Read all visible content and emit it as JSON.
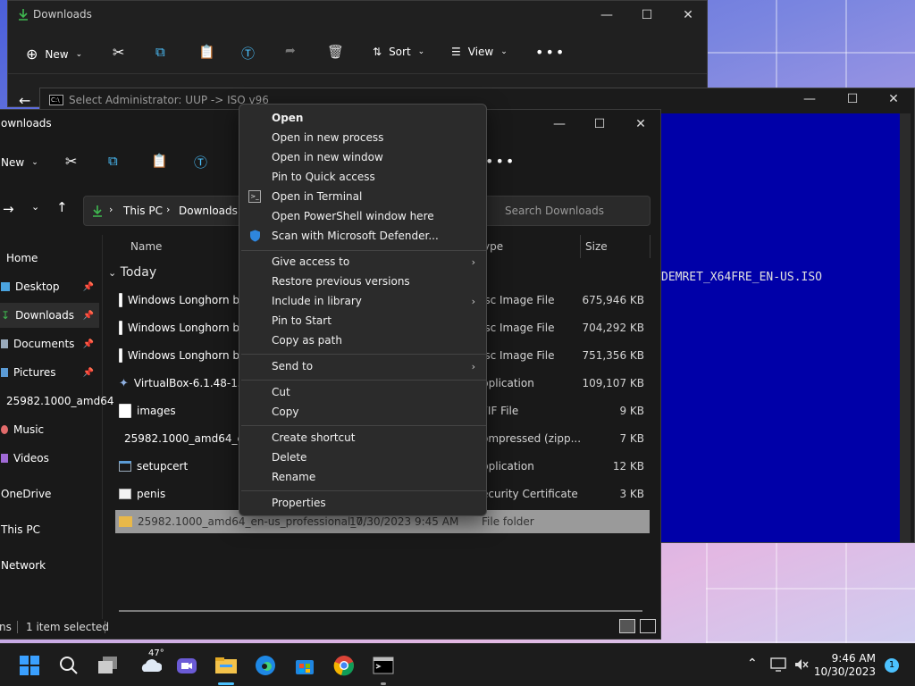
{
  "back_explorer": {
    "title": "Downloads",
    "new_label": "New",
    "sort_label": "Sort",
    "view_label": "View"
  },
  "console": {
    "title": "Select Administrator:  UUP -> ISO v96",
    "output_line": "DEMRET_X64FRE_EN-US.ISO"
  },
  "explorer": {
    "title": "ownloads",
    "new_label": "New",
    "breadcrumb": [
      "This PC",
      "Downloads"
    ],
    "search_placeholder": "Search Downloads",
    "columns": {
      "name": "Name",
      "type": "ype",
      "size": "Size"
    },
    "group": "Today",
    "nav": [
      {
        "label": "Home"
      },
      {
        "label": "Desktop",
        "pinned": true
      },
      {
        "label": "Downloads",
        "pinned": true
      },
      {
        "label": "Documents",
        "pinned": true
      },
      {
        "label": "Pictures",
        "pinned": true
      },
      {
        "label": "25982.1000_amd64"
      },
      {
        "label": "Music"
      },
      {
        "label": "Videos"
      },
      {
        "label": "OneDrive"
      },
      {
        "label": "This PC"
      },
      {
        "label": "Network"
      }
    ],
    "rows": [
      {
        "name": "Windows Longhorn b",
        "type": "isc Image File",
        "size": "675,946 KB"
      },
      {
        "name": "Windows Longhorn b",
        "type": "isc Image File",
        "size": "704,292 KB"
      },
      {
        "name": "Windows Longhorn b",
        "type": "isc Image File",
        "size": "751,356 KB"
      },
      {
        "name": "VirtualBox-6.1.48-159",
        "type": "pplication",
        "size": "109,107 KB"
      },
      {
        "name": "images",
        "type": "FIF File",
        "size": "9 KB"
      },
      {
        "name": "25982.1000_amd64_en",
        "type": "ompressed (zipp...",
        "size": "7 KB"
      },
      {
        "name": "setupcert",
        "type": "pplication",
        "size": "12 KB"
      },
      {
        "name": "penis",
        "type": "ecurity Certificate",
        "size": "3 KB"
      }
    ],
    "selected_row": {
      "name": "25982.1000_amd64_en-us_professional_7...",
      "date": "10/30/2023 9:45 AM",
      "type": "File folder"
    },
    "status_left": "ns",
    "status_selected": "1 item selected"
  },
  "context_menu": {
    "items": [
      {
        "label": "Open",
        "bold": true
      },
      {
        "label": "Open in new process"
      },
      {
        "label": "Open in new window"
      },
      {
        "label": "Pin to Quick access"
      },
      {
        "label": "Open in Terminal",
        "icon": "terminal-icon"
      },
      {
        "label": "Open PowerShell window here"
      },
      {
        "label": "Scan with Microsoft Defender...",
        "icon": "defender-shield-icon"
      },
      {
        "label": "Give access to",
        "submenu": true
      },
      {
        "label": "Restore previous versions"
      },
      {
        "label": "Include in library",
        "submenu": true
      },
      {
        "label": "Pin to Start"
      },
      {
        "label": "Copy as path"
      },
      {
        "label": "Send to",
        "submenu": true
      },
      {
        "label": "Cut"
      },
      {
        "label": "Copy"
      },
      {
        "label": "Create shortcut"
      },
      {
        "label": "Delete"
      },
      {
        "label": "Rename"
      },
      {
        "label": "Properties"
      }
    ]
  },
  "taskbar": {
    "weather_temp": "47°",
    "time": "9:46 AM",
    "date": "10/30/2023",
    "notification_count": "1"
  },
  "colors": {
    "accent": "#4cc2ff",
    "console_bg": "#0000a8",
    "download_green": "#3fb950"
  }
}
